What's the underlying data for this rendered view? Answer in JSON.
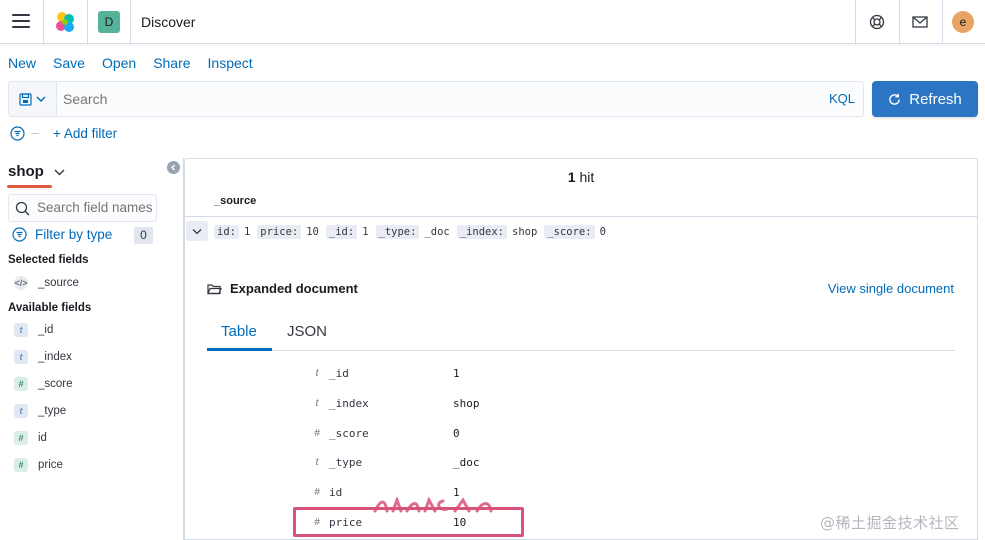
{
  "header": {
    "space_initial": "D",
    "app_title": "Discover",
    "avatar_initial": "e",
    "icons": [
      "menu-icon",
      "elastic-logo-icon",
      "help-icon",
      "mail-icon"
    ]
  },
  "menu": {
    "new": "New",
    "save": "Save",
    "open": "Open",
    "share": "Share",
    "inspect": "Inspect"
  },
  "query": {
    "placeholder": "Search",
    "language": "KQL",
    "refresh_label": "Refresh"
  },
  "filters": {
    "add_filter": "+ Add filter"
  },
  "sidebar": {
    "index_pattern": "shop",
    "search_placeholder": "Search field names",
    "filter_by_type": "Filter by type",
    "filter_count": "0",
    "selected_title": "Selected fields",
    "selected_fields": [
      {
        "type": "source",
        "name": "_source"
      }
    ],
    "available_title": "Available fields",
    "available_fields": [
      {
        "type": "t",
        "name": "_id"
      },
      {
        "type": "t",
        "name": "_index"
      },
      {
        "type": "#",
        "name": "_score"
      },
      {
        "type": "t",
        "name": "_type"
      },
      {
        "type": "#",
        "name": "id"
      },
      {
        "type": "#",
        "name": "price"
      }
    ]
  },
  "results": {
    "hit_count": "1",
    "hit_label": "hit",
    "column_header": "_source",
    "source_pairs": [
      {
        "key": "id:",
        "value": "1"
      },
      {
        "key": "price:",
        "value": "10"
      },
      {
        "key": "_id:",
        "value": "1"
      },
      {
        "key": "_type:",
        "value": "_doc"
      },
      {
        "key": "_index:",
        "value": "shop"
      },
      {
        "key": "_score:",
        "value": "0"
      }
    ],
    "expanded_title": "Expanded document",
    "view_single": "View single document",
    "tabs": [
      "Table",
      "JSON"
    ],
    "doc_fields": [
      {
        "type": "t",
        "name": "_id",
        "value": "1"
      },
      {
        "type": "t",
        "name": "_index",
        "value": "shop"
      },
      {
        "type": "#",
        "name": "_score",
        "value": "0"
      },
      {
        "type": "t",
        "name": "_type",
        "value": "_doc"
      },
      {
        "type": "#",
        "name": "id",
        "value": "1"
      },
      {
        "type": "#",
        "name": "price",
        "value": "10"
      }
    ]
  },
  "watermark": "@稀土掘金技术社区",
  "colors": {
    "accent": "#006bb8",
    "refresh_bg": "#2c75c4",
    "space_badge": "#54b399",
    "avatar": "#e7a465",
    "highlight": "#d9547a",
    "underline": "#e05a3c"
  }
}
